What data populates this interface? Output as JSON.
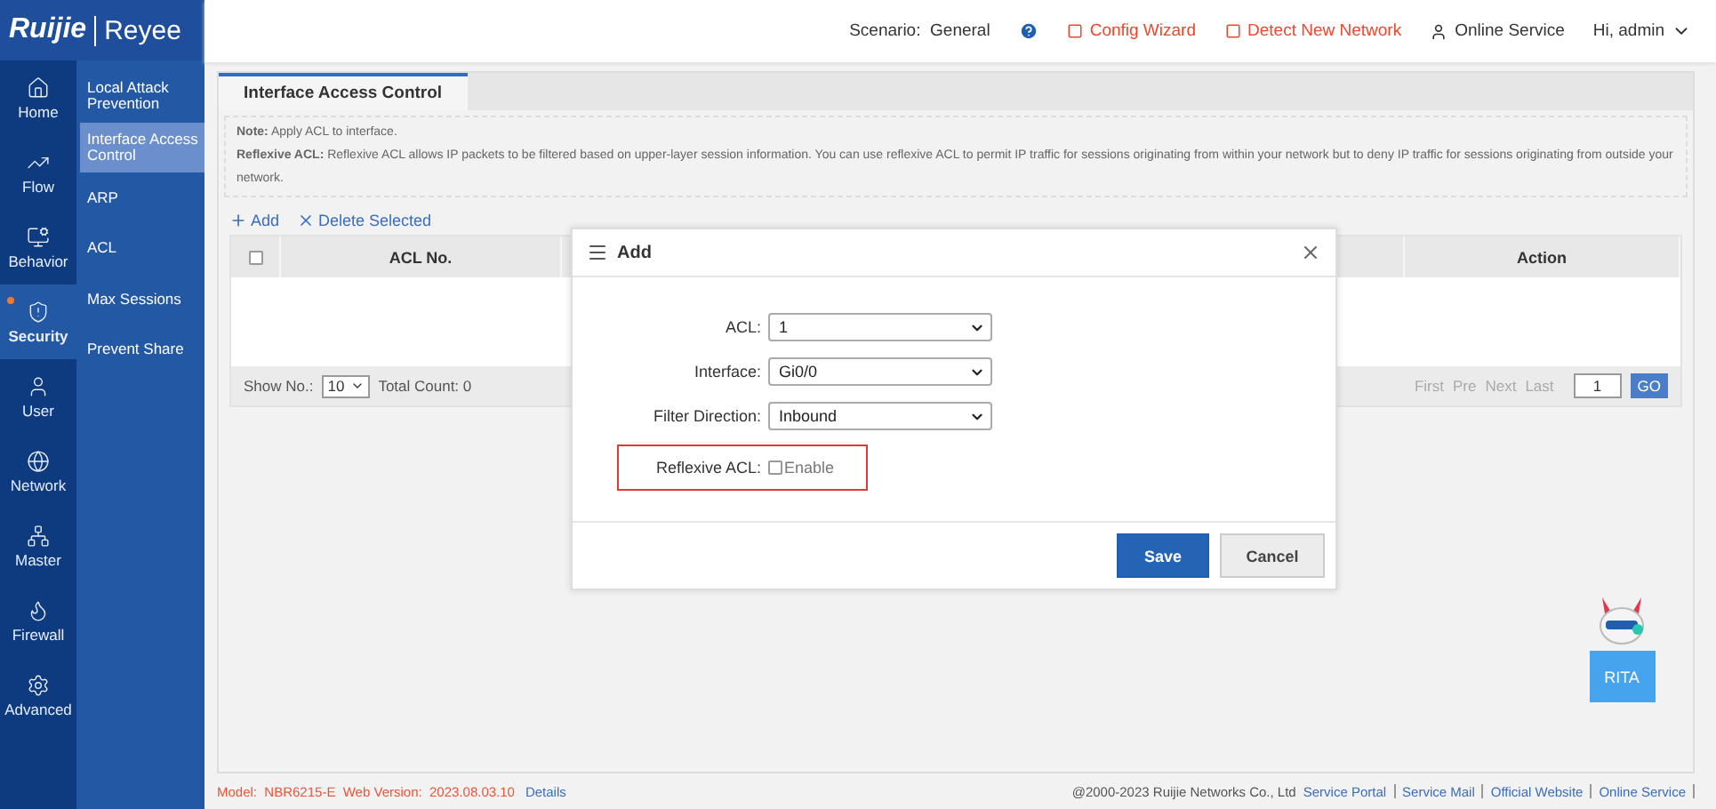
{
  "logo": {
    "brand": "Ruijie",
    "sub_brand": "Reyee"
  },
  "nav": [
    {
      "label": "Home",
      "selected": false,
      "alert": false
    },
    {
      "label": "Flow",
      "selected": false,
      "alert": false
    },
    {
      "label": "Behavior",
      "selected": false,
      "alert": false
    },
    {
      "label": "Security",
      "selected": true,
      "alert": true
    },
    {
      "label": "User",
      "selected": false,
      "alert": false
    },
    {
      "label": "Network",
      "selected": false,
      "alert": false
    },
    {
      "label": "Master",
      "selected": false,
      "alert": false
    },
    {
      "label": "Firewall",
      "selected": false,
      "alert": false
    },
    {
      "label": "Advanced",
      "selected": false,
      "alert": false
    }
  ],
  "submenu": [
    {
      "label": "Local Attack Prevention",
      "selected": false
    },
    {
      "label": "Interface Access Control",
      "selected": true
    },
    {
      "label": "ARP",
      "selected": false
    },
    {
      "label": "ACL",
      "selected": false
    },
    {
      "label": "Max Sessions",
      "selected": false
    },
    {
      "label": "Prevent Share",
      "selected": false
    }
  ],
  "header": {
    "scenario_label": "Scenario:",
    "scenario": "General",
    "config_wizard": "Config Wizard",
    "detect": "Detect New Network",
    "online_service": "Online Service",
    "user": "Hi, admin"
  },
  "tabs": [
    {
      "label": "Interface Access Control",
      "selected": true
    }
  ],
  "notes": [
    "**Note:** Apply ACL to interface.",
    "**Reflexive ACL:** Reflexive ACL allows IP packets to be filtered based on upper-layer session information. You can use reflexive ACL to permit IP traffic for sessions originating from within your network but to deny IP traffic for sessions originating from outside your network."
  ],
  "toolbar": {
    "add": "Add",
    "delete": "Delete Selected"
  },
  "table": {
    "columns": [
      "ACL No.",
      "Action"
    ],
    "all_checked": false
  },
  "pagination": {
    "show_label": "Show No.:",
    "page_size": "10",
    "total": "Total Count: 0",
    "first": "First",
    "prev": "Pre",
    "next": "Next",
    "last": "Last",
    "page": "1",
    "go": "GO"
  },
  "dialog": {
    "title": "Add",
    "fields": [
      {
        "kind": "select",
        "label": "ACL:",
        "value": "1",
        "highlighted": false
      },
      {
        "kind": "select",
        "label": "Interface:",
        "value": "Gi0/0",
        "highlighted": false
      },
      {
        "kind": "select",
        "label": "Filter Direction:",
        "value": "Inbound",
        "highlighted": false
      },
      {
        "kind": "checkbox",
        "label": "Reflexive ACL:",
        "option": "Enable",
        "checked": false,
        "highlighted": true
      }
    ],
    "buttons": [
      {
        "label": "Save",
        "kind": "primary"
      },
      {
        "label": "Cancel",
        "kind": "secondary"
      }
    ]
  },
  "assistant": {
    "label": "RITA"
  },
  "footer": {
    "model": "Model:  NBR6215-E  Web Version:  2023.08.03.10",
    "details": "Details",
    "copyright": "@2000-2023 Ruijie Networks Co., Ltd",
    "links": [
      "Service Portal",
      "Service Mail",
      "Official Website",
      "Online Service"
    ]
  }
}
